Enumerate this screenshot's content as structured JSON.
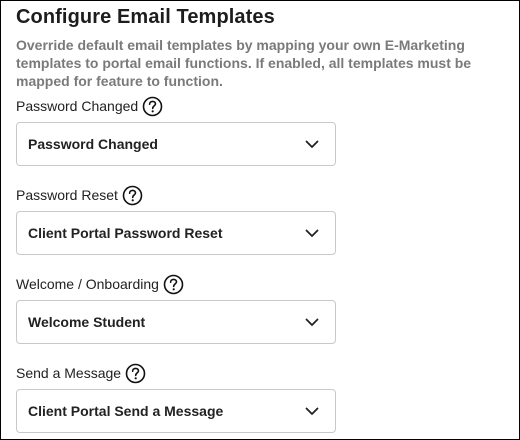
{
  "header": {
    "title": "Configure Email Templates",
    "description": "Override default email templates by mapping your own E-Marketing templates to portal email functions. If enabled, all templates must be mapped for feature to function."
  },
  "fields": [
    {
      "label": "Password Changed",
      "selected": "Password Changed",
      "help_icon": "question-circle-icon"
    },
    {
      "label": "Password Reset",
      "selected": "Client Portal Password Reset",
      "help_icon": "question-circle-icon"
    },
    {
      "label": "Welcome / Onboarding",
      "selected": "Welcome Student",
      "help_icon": "question-circle-icon"
    },
    {
      "label": "Send a Message",
      "selected": "Client Portal Send a Message",
      "help_icon": "question-circle-icon"
    }
  ]
}
